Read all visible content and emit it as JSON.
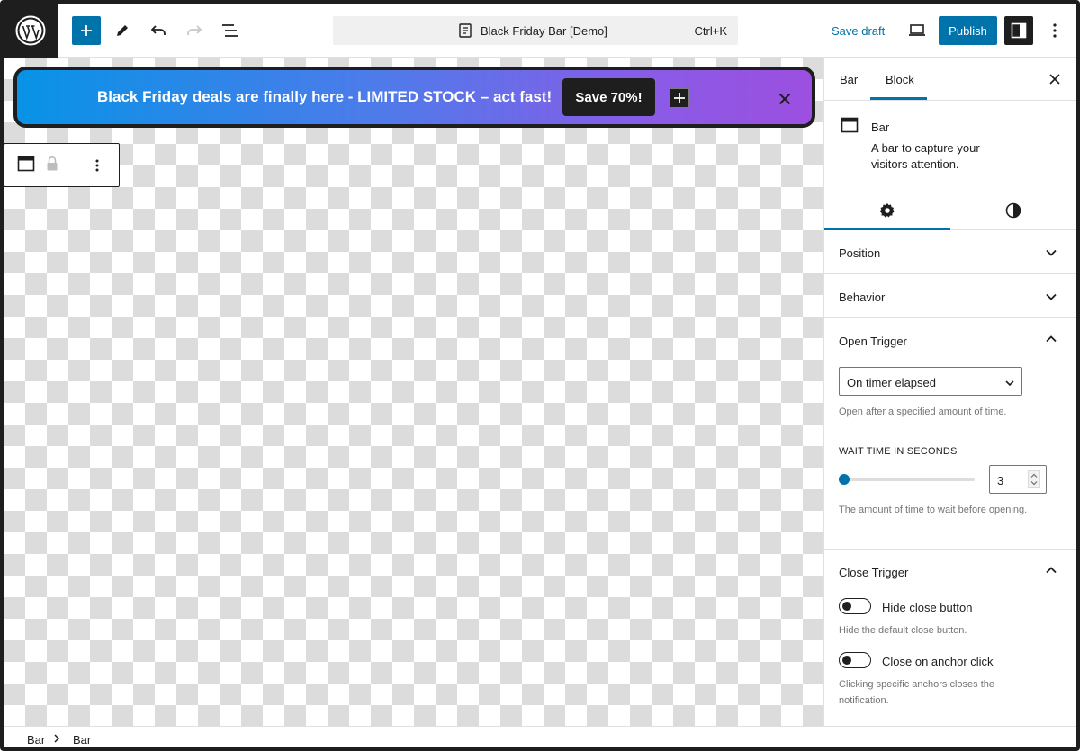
{
  "header": {
    "command_title": "Black Friday Bar [Demo]",
    "command_shortcut": "Ctrl+K",
    "save_draft_label": "Save draft",
    "publish_label": "Publish"
  },
  "canvas": {
    "bar": {
      "text": "Black Friday deals are finally here - LIMITED STOCK – act fast!",
      "cta_label": "Save 70%!"
    }
  },
  "sidebar": {
    "tabs": [
      {
        "label": "Bar"
      },
      {
        "label": "Block",
        "active": true
      }
    ],
    "block": {
      "name": "Bar",
      "description": "A bar to capture your visitors attention."
    },
    "panels": {
      "position": {
        "title": "Position",
        "expanded": false
      },
      "behavior": {
        "title": "Behavior",
        "expanded": false
      },
      "open_trigger": {
        "title": "Open Trigger",
        "expanded": true,
        "select_value": "On timer elapsed",
        "select_help": "Open after a specified amount of time.",
        "wait_label": "WAIT TIME IN SECONDS",
        "wait_value": "3",
        "wait_help": "The amount of time to wait before opening."
      },
      "close_trigger": {
        "title": "Close Trigger",
        "expanded": true,
        "hide_close_label": "Hide close button",
        "hide_close_help": "Hide the default close button.",
        "anchor_close_label": "Close on anchor click",
        "anchor_close_help": "Clicking specific anchors closes the notification."
      }
    }
  },
  "footer": {
    "breadcrumb": [
      "Bar",
      "Bar"
    ]
  },
  "colors": {
    "accent": "#0073aa",
    "dark": "#1e1e1e",
    "bar_gradient_start": "#0793e6",
    "bar_gradient_end": "#9c4fe0"
  }
}
